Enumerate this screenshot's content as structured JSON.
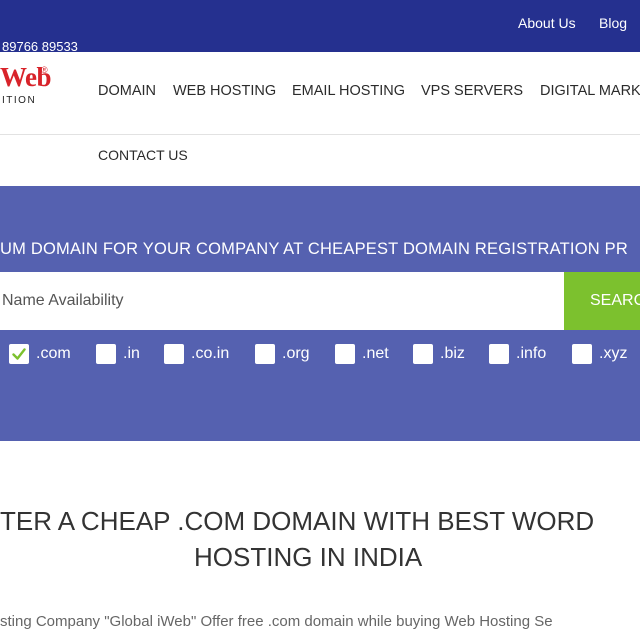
{
  "topbar": {
    "phone": "89766 89533",
    "links": [
      {
        "label": "About Us"
      },
      {
        "label": "Blog"
      }
    ]
  },
  "logo": {
    "text": "Web",
    "registered": "®",
    "subtitle": "ITION"
  },
  "nav": {
    "items": [
      {
        "label": "DOMAIN"
      },
      {
        "label": "WEB HOSTING"
      },
      {
        "label": "EMAIL HOSTING"
      },
      {
        "label": "VPS SERVERS"
      },
      {
        "label": "DIGITAL MARK"
      },
      {
        "label": "CONTACT US"
      }
    ]
  },
  "hero": {
    "title": "UM DOMAIN FOR YOUR COMPANY AT CHEAPEST DOMAIN REGISTRATION PR",
    "search": {
      "placeholder": "Name Availability",
      "button_label": "SEARCH"
    },
    "tlds": [
      {
        "label": ".com",
        "checked": true
      },
      {
        "label": ".in",
        "checked": false
      },
      {
        "label": ".co.in",
        "checked": false
      },
      {
        "label": ".org",
        "checked": false
      },
      {
        "label": ".net",
        "checked": false
      },
      {
        "label": ".biz",
        "checked": false
      },
      {
        "label": ".info",
        "checked": false
      },
      {
        "label": ".xyz",
        "checked": false
      }
    ]
  },
  "main": {
    "headline_line1": "TER A CHEAP .COM DOMAIN WITH BEST WORD",
    "headline_line2": "HOSTING IN INDIA",
    "subtext": "sting Company \"Global iWeb\" Offer free .com domain while buying Web Hosting Se"
  },
  "colors": {
    "topbar": "#25308f",
    "hero": "#5561b0",
    "search_button": "#7cc12e",
    "logo": "#d8232a",
    "check": "#7cc12e"
  }
}
